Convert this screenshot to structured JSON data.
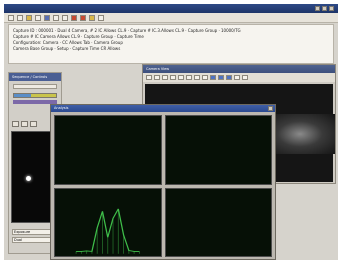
{
  "app": {
    "title": ""
  },
  "info_panel": {
    "lines": [
      "Capture ID : 000001 · Dual 4 Camera, # 2 IC Allows CL.9 · Capture # IC.3.Allows CL.9 · Capture Group · 10000/TG",
      "Capture # IC Camera Allows CL.9 · Capture Group · Capture Time",
      "Configuration: Camera · CC Allows Tab · Camera Group",
      "Camera Base Group · Setup · Capture Time CR Allows"
    ]
  },
  "left_panel": {
    "title": "Sequence / Controls",
    "footer_rows": [
      "Exposure",
      "Dual"
    ]
  },
  "side_window": {
    "title": "Camera View"
  },
  "scope_window": {
    "title": "Analysis"
  },
  "colors": {
    "titlebar": "#1d3468",
    "scope_trace": "#3fbf4a",
    "scope_background": "#061006"
  },
  "chart_data": {
    "type": "line",
    "series": [
      {
        "values": [
          0.05,
          0.05,
          0.06,
          0.05,
          0.55,
          0.9,
          0.35,
          0.75,
          0.95,
          0.4,
          0.07,
          0.05,
          0.05
        ]
      }
    ]
  }
}
